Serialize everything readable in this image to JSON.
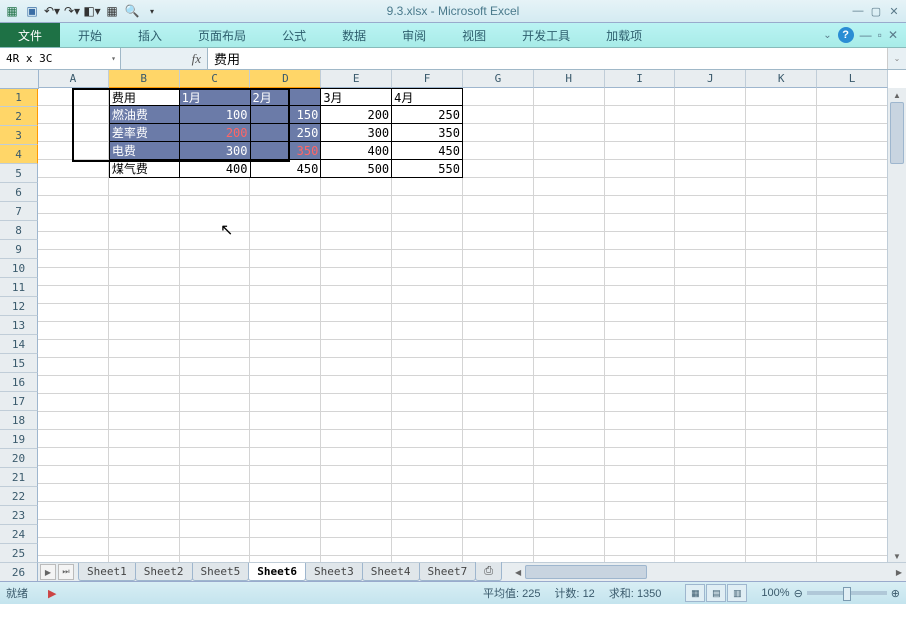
{
  "title": "9.3.xlsx - Microsoft Excel",
  "qat": {
    "excel": "▦",
    "save": "💾"
  },
  "ribbon": {
    "file": "文件",
    "tabs": [
      "开始",
      "插入",
      "页面布局",
      "公式",
      "数据",
      "审阅",
      "视图",
      "开发工具",
      "加载项"
    ]
  },
  "namebox": "4R x 3C",
  "formula": "费用",
  "columns": [
    "A",
    "B",
    "C",
    "D",
    "E",
    "F",
    "G",
    "H",
    "I",
    "J",
    "K",
    "L"
  ],
  "sel_cols": [
    "B",
    "C",
    "D"
  ],
  "sel_rows": [
    1,
    2,
    3,
    4
  ],
  "grid_rows": 27,
  "data": {
    "B1": "费用",
    "C1": "1月",
    "D1": "2月",
    "E1": "3月",
    "F1": "4月",
    "B2": "燃油费",
    "C2": "100",
    "D2": "150",
    "E2": "200",
    "F2": "250",
    "B3": "差率费",
    "C3": "200",
    "D3": "250",
    "E3": "300",
    "F3": "350",
    "B4": "电费",
    "C4": "300",
    "D4": "350",
    "E4": "400",
    "F4": "450",
    "B5": "煤气费",
    "C5": "400",
    "D5": "450",
    "E5": "500",
    "F5": "550"
  },
  "red_cells": [
    "C3",
    "D4"
  ],
  "sheets": [
    "Sheet1",
    "Sheet2",
    "Sheet5",
    "Sheet6",
    "Sheet3",
    "Sheet4",
    "Sheet7"
  ],
  "active_sheet": "Sheet6",
  "status": {
    "ready": "就绪",
    "avg_label": "平均值:",
    "avg": "225",
    "count_label": "计数:",
    "count": "12",
    "sum_label": "求和:",
    "sum": "1350",
    "zoom": "100%"
  },
  "chart_data": {
    "type": "table",
    "title": "费用",
    "categories": [
      "1月",
      "2月",
      "3月",
      "4月"
    ],
    "series": [
      {
        "name": "燃油费",
        "values": [
          100,
          150,
          200,
          250
        ]
      },
      {
        "name": "差率费",
        "values": [
          200,
          250,
          300,
          350
        ]
      },
      {
        "name": "电费",
        "values": [
          300,
          350,
          400,
          450
        ]
      },
      {
        "name": "煤气费",
        "values": [
          400,
          450,
          500,
          550
        ]
      }
    ]
  }
}
